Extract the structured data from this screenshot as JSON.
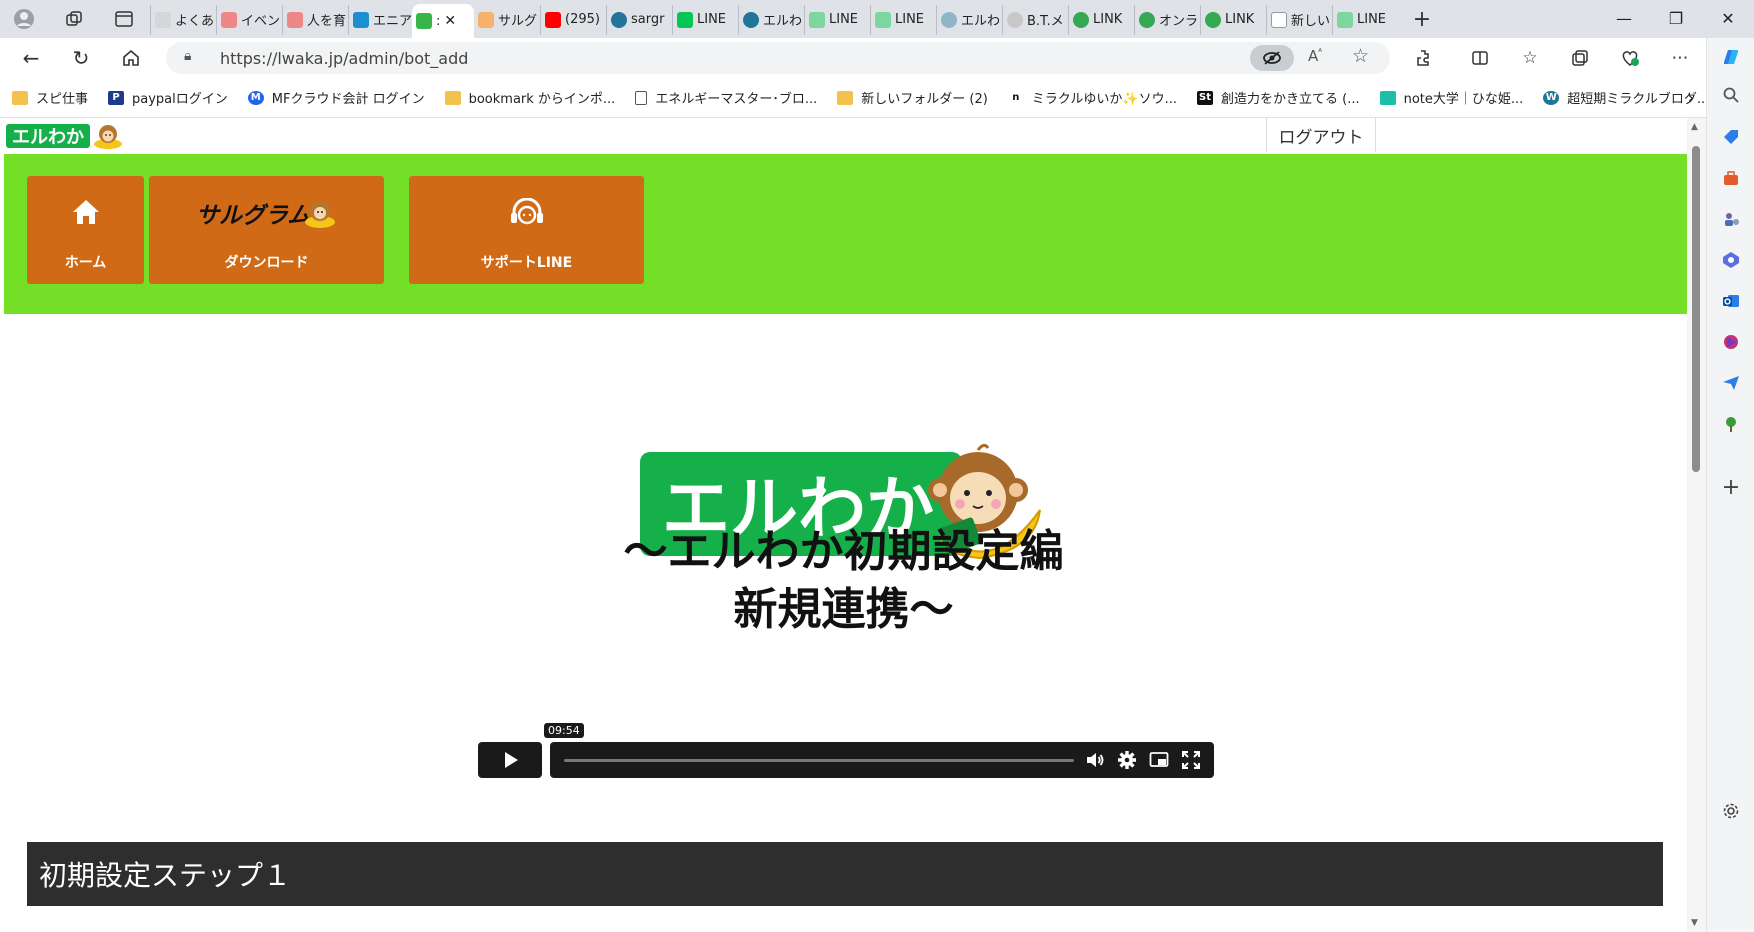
{
  "browser": {
    "tabs": [
      {
        "label": "よくあ",
        "color": "#c7c7c7"
      },
      {
        "label": "イベン",
        "color": "#e04848"
      },
      {
        "label": "人を育",
        "color": "#e04848"
      },
      {
        "label": "エニア",
        "color": "#1b8fd0"
      },
      {
        "label": ":",
        "color": "#3ab54a",
        "active": true
      },
      {
        "label": "サルグ",
        "color": "#f08a24"
      },
      {
        "label": "(295)",
        "color": "#ff0000"
      },
      {
        "label": "sargr",
        "color": "#21759b"
      },
      {
        "label": "LINE",
        "color": "#06c755"
      },
      {
        "label": "エルわ",
        "color": "#21759b"
      },
      {
        "label": "LINE",
        "color": "#06c755"
      },
      {
        "label": "LINE",
        "color": "#06c755"
      },
      {
        "label": "エルわ",
        "color": "#21759b"
      },
      {
        "label": "B.T.メ",
        "color": "#9a9a9a"
      },
      {
        "label": "LINK",
        "color": "#34a853"
      },
      {
        "label": "オンラ",
        "color": "#34a853"
      },
      {
        "label": "LINK",
        "color": "#34a853"
      },
      {
        "label": "新しい",
        "color": "#9a9a9a"
      },
      {
        "label": "LINE",
        "color": "#06c755"
      }
    ],
    "url": "https://lwaka.jp/admin/bot_add",
    "bookmarks": [
      {
        "label": "スピ仕事",
        "icon": "folder-icon",
        "color": "#f2c14e"
      },
      {
        "label": "paypalログイン",
        "icon": "paypal-icon",
        "color": "#1e3a8a"
      },
      {
        "label": "MFクラウド会計 ログイン",
        "icon": "mf-icon",
        "color": "#2563eb"
      },
      {
        "label": "bookmark からインポ...",
        "icon": "folder-icon",
        "color": "#f2c14e"
      },
      {
        "label": "エネルギーマスター･ブロ...",
        "icon": "page-icon",
        "color": "#555555"
      },
      {
        "label": "新しいフォルダー (2)",
        "icon": "folder-icon",
        "color": "#f2c14e"
      },
      {
        "label": "ミラクルゆいか✨ソウ...",
        "icon": "note-icon",
        "color": "#111111"
      },
      {
        "label": "創造力をかき立てる (...",
        "icon": "st-icon",
        "color": "#111111"
      },
      {
        "label": "note大学｜ひな姫...",
        "icon": "note-square-icon",
        "color": "#1fbfa6"
      },
      {
        "label": "超短期ミラクルブログ...",
        "icon": "wordpress-icon",
        "color": "#21759b"
      }
    ]
  },
  "site": {
    "logo_text": "エルわか",
    "logout_label": "ログアウト",
    "menu": [
      {
        "label": "ホーム",
        "icon": "home-icon"
      },
      {
        "label": "ダウンロード",
        "icon": "sarugram-logo",
        "logo_text": "サルグラム"
      },
      {
        "label": "サポートLINE",
        "icon": "headset-icon"
      }
    ],
    "menu_color": "#d06a16",
    "band_color": "#73e027",
    "hero_logo_text": "エルわか",
    "headline_line1": "〜エルわか初期設定編",
    "headline_line2": "新規連携〜",
    "video": {
      "duration": "09:54",
      "progress": 0
    },
    "section_title": "初期設定ステップ１"
  }
}
